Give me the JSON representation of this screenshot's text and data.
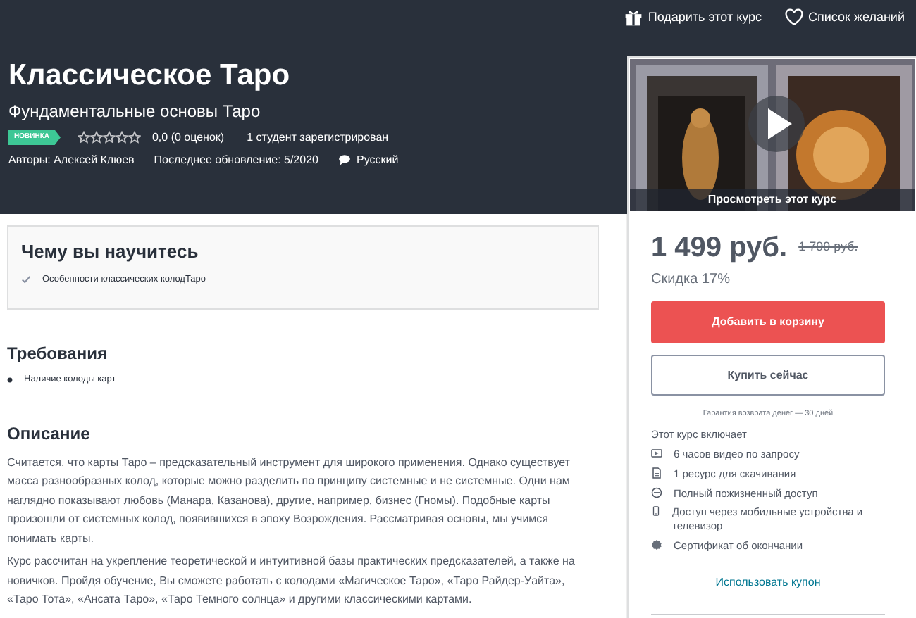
{
  "header": {
    "actions": [
      {
        "label": "Подарить этот курс"
      },
      {
        "label": "Список желаний"
      }
    ],
    "title": "Классическое Таро",
    "subtitle": "Фундаментальные основы Таро",
    "badge": "НОВИНКА",
    "stars": 0,
    "rating": "0,0 (0 оценок)",
    "students": "1 студент зарегистрирован",
    "authors": "Авторы: Алексей Клюев",
    "updated": "Последнее обновление: 5/2020",
    "language": "Русский"
  },
  "sidebar": {
    "preview_caption": "Просмотреть этот курс",
    "price": "1 499 руб.",
    "old_price": "1 799 руб.",
    "discount": "Скидка 17%",
    "add_to_cart": "Добавить в корзину",
    "buy_now": "Купить сейчас",
    "guarantee": "Гарантия возврата денег — 30 дней",
    "includes_title": "Этот курс включает",
    "includes": [
      "6 часов видео по запросу",
      "1 ресурс для скачивания",
      "Полный пожизненный доступ",
      "Доступ через мобильные устройства и телевизор",
      "Сертификат об окончании"
    ],
    "coupon": "Использовать купон"
  },
  "learn": {
    "title": "Чему вы научитесь",
    "items": [
      "Особенности классических колодТаро"
    ]
  },
  "requirements": {
    "title": "Требования",
    "items": [
      "Наличие колоды карт"
    ]
  },
  "description": {
    "title": "Описание",
    "paragraphs": [
      "Считается, что карты Таро – предсказательный инструмент для широкого применения. Однако существует масса разнообразных колод, которые можно разделить по принципу системные и не системные. Одни нам наглядно показывают любовь (Манара, Казанова), другие, например, бизнес (Гномы). Подобные карты произошли от системных колод, появившихся в эпоху Возрождения. Рассматривая основы, мы учимся понимать карты.",
      "Курс рассчитан на укрепление теоретической и интуитивной базы практических предсказателей, а также на новичков. Пройдя обучение, Вы сможете работать с колодами «Магическое Таро», «Таро Райдер-Уайта», «Таро Тота», «Ансата Таро», «Таро Темного солнца» и другими классическими картами."
    ]
  }
}
